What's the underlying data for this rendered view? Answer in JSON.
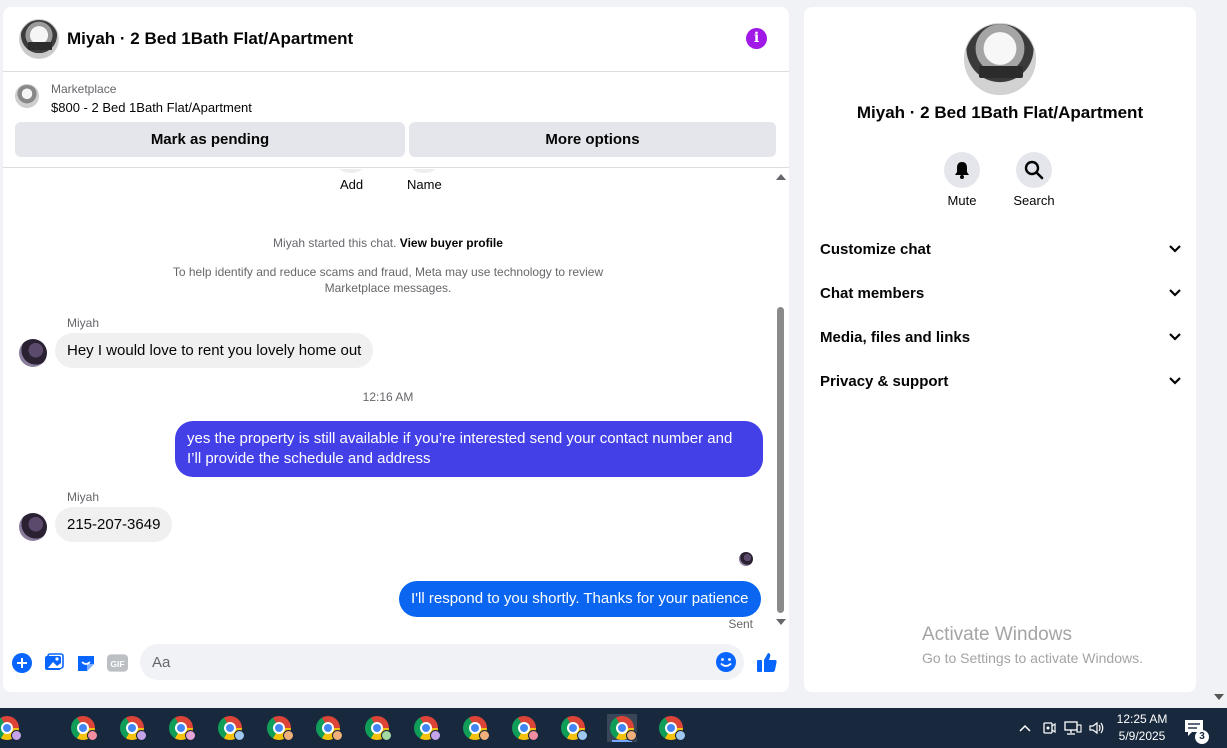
{
  "chat": {
    "title": "Miyah · 2 Bed 1Bath Flat/Apartment",
    "marketplace_label": "Marketplace",
    "listing_price_title": "$800 - 2 Bed 1Bath Flat/Apartment",
    "mark_pending_label": "Mark as pending",
    "more_options_label": "More options",
    "top_actions": [
      "Add",
      "Name"
    ],
    "system_started_prefix": "Miyah started this chat.",
    "system_started_link": "View buyer profile",
    "scam_notice_line1": "To help identify and reduce scams and fraud, Meta may use technology to review",
    "scam_notice_line2": "Marketplace messages.",
    "messages": [
      {
        "sender": "Miyah",
        "text": "Hey I would love to rent you lovely home out"
      },
      {
        "timestamp": "12:16 AM"
      },
      {
        "text_line1": "yes the property is still available if you’re interested send your contact number and",
        "text_line2": "I’ll provide the schedule and address",
        "color": "#4340e8"
      },
      {
        "sender": "Miyah",
        "text": "215-207-3649"
      },
      {
        "text": "I'll respond to you shortly. Thanks for your patience",
        "color": "#0a66f0",
        "status": "Sent"
      }
    ],
    "composer": {
      "placeholder": "Aa",
      "icons": [
        "plus-circle-icon",
        "image-icon",
        "sticker-icon",
        "gif-icon",
        "emoji-icon",
        "thumbs-up-icon"
      ],
      "gif_text": "GIF"
    },
    "accent_color": "#0866ff"
  },
  "info_panel": {
    "name": "Miyah · 2 Bed 1Bath Flat/Apartment",
    "actions": [
      {
        "label": "Mute",
        "icon": "bell-icon"
      },
      {
        "label": "Search",
        "icon": "search-icon"
      }
    ],
    "sections": [
      "Customize chat",
      "Chat members",
      "Media, files and links",
      "Privacy & support"
    ]
  },
  "watermark": {
    "title": "Activate Windows",
    "subtitle": "Go to Settings to activate Windows."
  },
  "taskbar": {
    "app_count": 14,
    "app_icon": "chrome-icon",
    "time": "12:25 AM",
    "date": "5/9/2025",
    "notification_count": "3"
  }
}
